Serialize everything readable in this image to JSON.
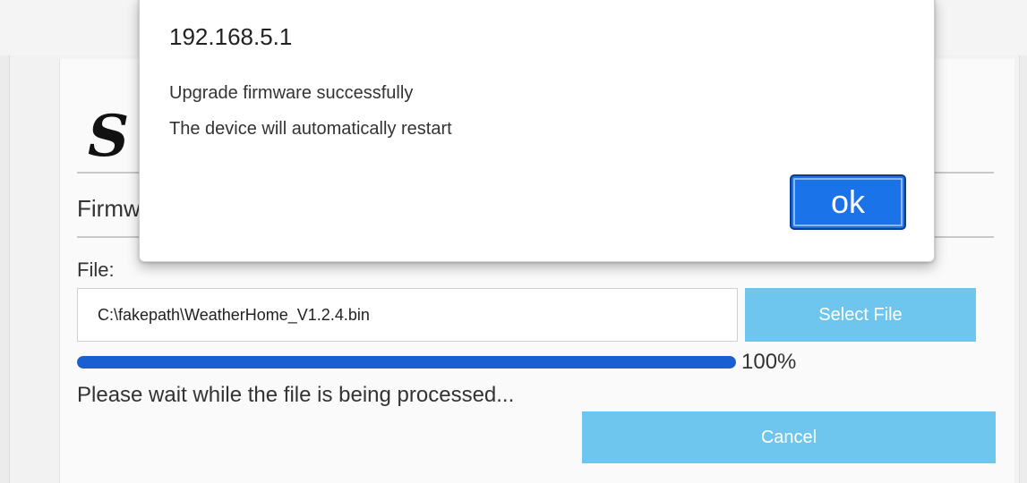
{
  "dialog": {
    "origin": "192.168.5.1",
    "message_line1": "Upgrade firmware successfully",
    "message_line2": "The device will automatically restart",
    "ok_label": "ok"
  },
  "page": {
    "logo_text": "S",
    "section_title": "Firmware",
    "file_label": "File:",
    "file_value": "C:\\fakepath\\WeatherHome_V1.2.4.bin",
    "select_button_label": "Select File",
    "progress_percent": 100,
    "progress_label": "100%",
    "status_text": "Please wait while the file is being processed...",
    "cancel_button_label": "Cancel"
  },
  "colors": {
    "button_light_blue": "#6ec6ee",
    "progress_blue": "#1a5fd1",
    "dialog_button_blue": "#1a73e8"
  }
}
